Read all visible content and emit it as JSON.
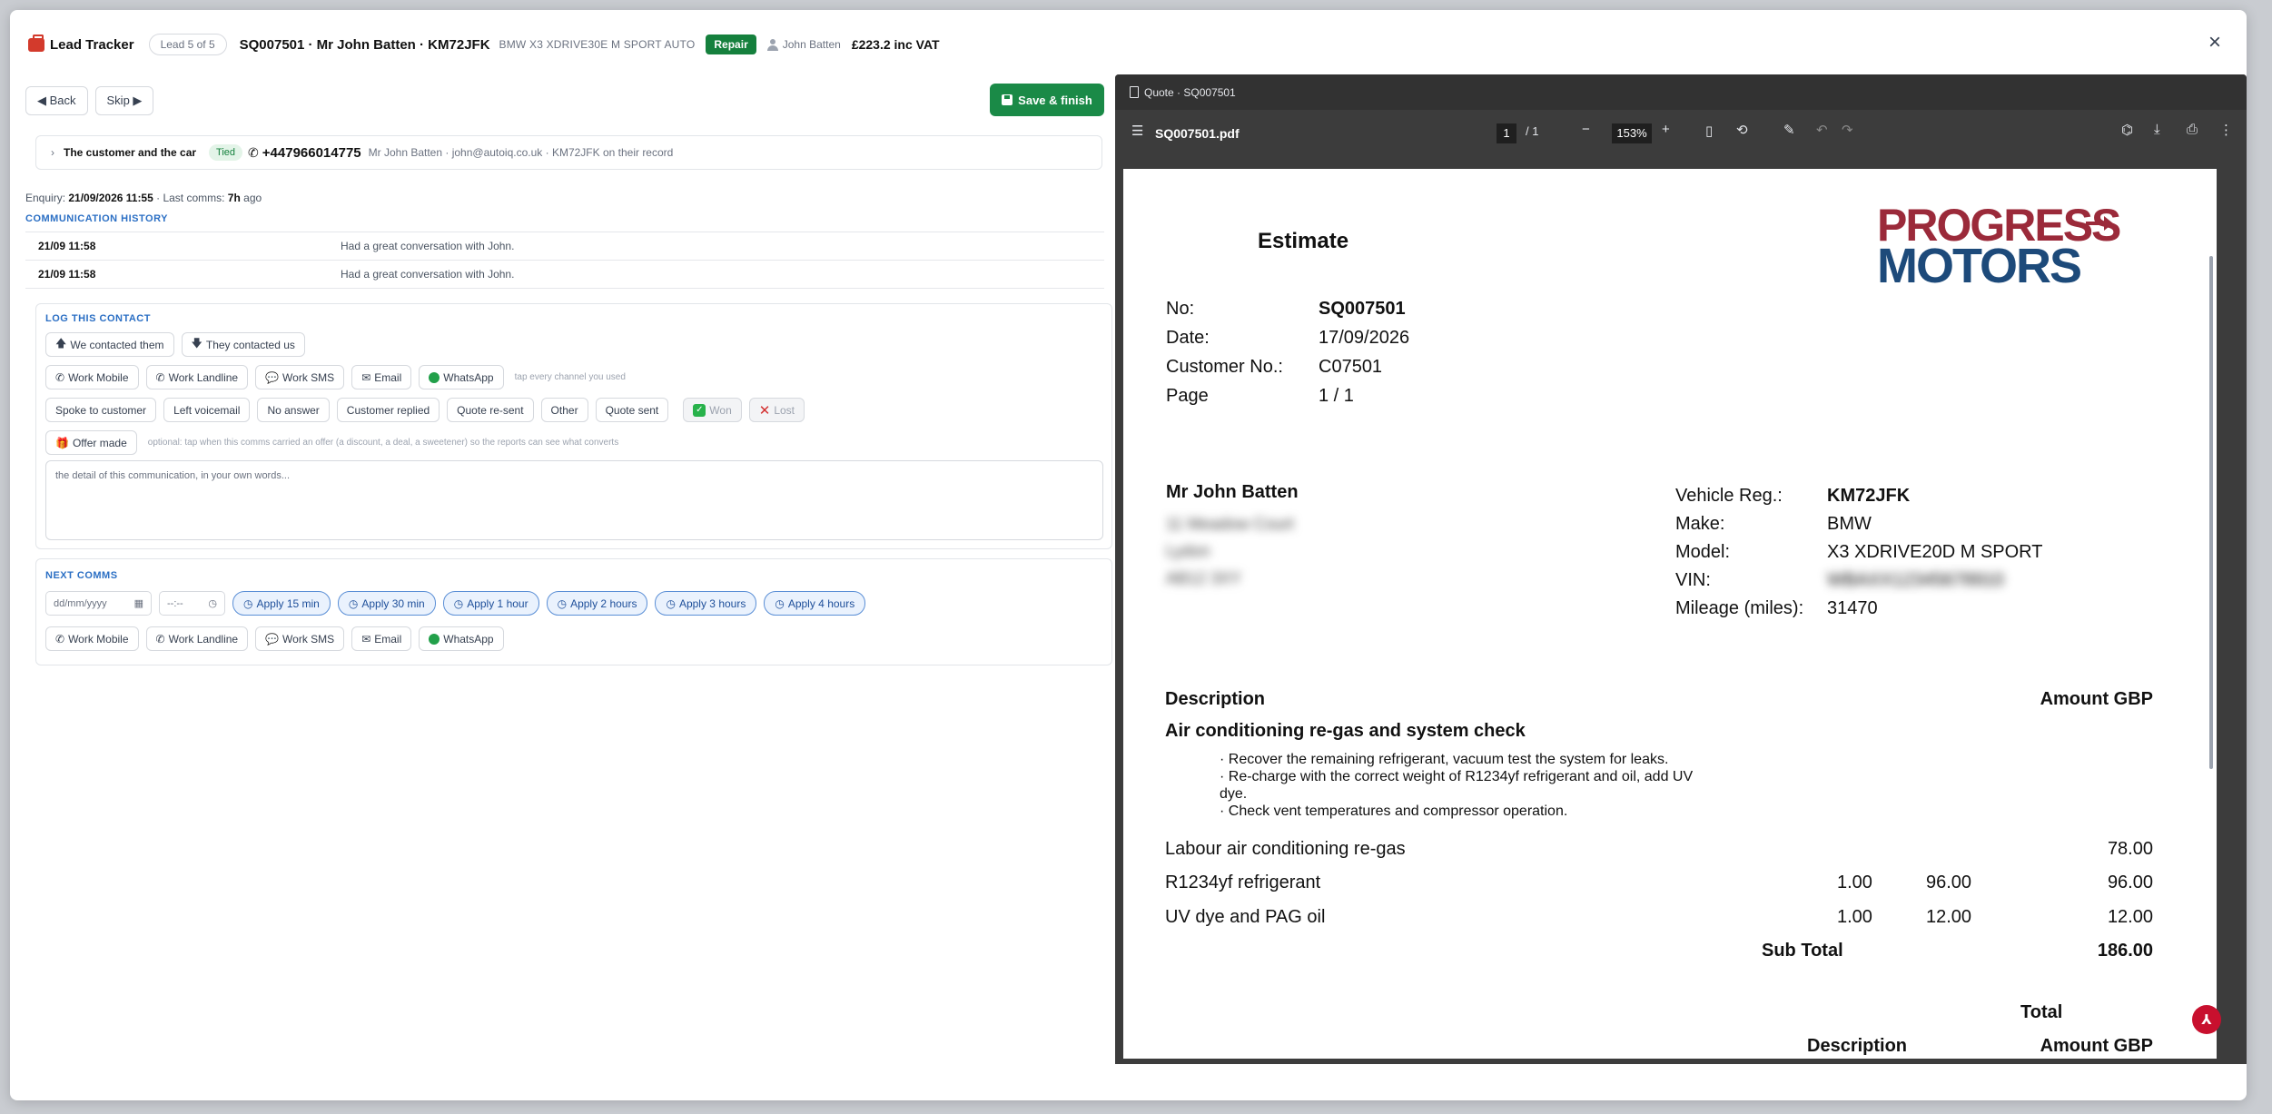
{
  "header": {
    "brand": "Lead Tracker",
    "lead_position": "Lead 5 of 5",
    "title": "SQ007501 · Mr John Batten · KM72JFK",
    "vehicle": "BMW X3 XDRIVE30E M SPORT AUTO",
    "badge": "Repair",
    "user": "John Batten",
    "price": "£223.2 inc VAT",
    "close": "×"
  },
  "toolbar": {
    "back": "◀ Back",
    "skip": "Skip ▶",
    "save": "Save & finish"
  },
  "customer": {
    "chevron": "›",
    "label": "The customer and the car",
    "status": "Tied",
    "phone": "+447966014775",
    "details": "Mr John Batten · john@autoiq.co.uk · KM72JFK on their record"
  },
  "enquiry": {
    "prefix": "Enquiry: ",
    "date": "21/09/2026 11:55",
    "sep": " · Last comms: ",
    "last": "7h",
    "suffix": " ago"
  },
  "history": {
    "title": "COMMUNICATION HISTORY",
    "rows": [
      {
        "time": "21/09 11:58",
        "message": "Had a great conversation with John."
      },
      {
        "time": "21/09 11:58",
        "message": "Had a great conversation with John."
      }
    ]
  },
  "log": {
    "title": "LOG THIS CONTACT",
    "direction": [
      "We contacted them",
      "They contacted us"
    ],
    "channels": [
      "Work Mobile",
      "Work Landline",
      "Work SMS",
      "Email",
      "WhatsApp"
    ],
    "channel_hint": "tap every channel you used",
    "outcomes": [
      "Spoke to customer",
      "Left voicemail",
      "No answer",
      "Customer replied",
      "Quote re-sent",
      "Other",
      "Quote sent"
    ],
    "won": "Won",
    "lost": "Lost",
    "offer": "Offer made",
    "offer_hint": "optional: tap when this comms carried an offer (a discount, a deal, a sweetener) so the reports can see what converts",
    "placeholder": "the detail of this communication, in your own words..."
  },
  "next": {
    "title": "NEXT COMMS",
    "date_placeholder": "dd/mm/yyyy",
    "time_placeholder": "--:--",
    "apply": [
      "Apply 15 min",
      "Apply 30 min",
      "Apply 1 hour",
      "Apply 2 hours",
      "Apply 3 hours",
      "Apply 4 hours"
    ],
    "channels": [
      "Work Mobile",
      "Work Landline",
      "Work SMS",
      "Email",
      "WhatsApp"
    ]
  },
  "pdf": {
    "tab": "Quote · SQ007501",
    "filename": "SQ007501.pdf",
    "page": "1",
    "of": "/  1",
    "zoom": "153%"
  },
  "estimate": {
    "heading": "Estimate",
    "logo_top": "PROGRESS",
    "logo_bottom": "MOTORS",
    "meta": [
      {
        "label": "No:",
        "value": "SQ007501"
      },
      {
        "label": "Date:",
        "value": "17/09/2026"
      },
      {
        "label": "Customer No.:",
        "value": "C07501"
      },
      {
        "label": "Page",
        "value": "1 / 1"
      }
    ],
    "customer_name": "Mr John Batten",
    "address": [
      "11 Meadow Court",
      "Lydon",
      "AB12 3XY"
    ],
    "vehicle": [
      {
        "label": "Vehicle Reg.:",
        "value": "KM72JFK"
      },
      {
        "label": "Make:",
        "value": "BMW"
      },
      {
        "label": "Model:",
        "value": "X3 XDRIVE20D M SPORT"
      },
      {
        "label": "VIN:",
        "value": "WBAXX12345678910"
      },
      {
        "label": "Mileage (miles):",
        "value": "31470"
      }
    ],
    "desc_header": "Description",
    "amount_header": "Amount GBP",
    "job_title": "Air conditioning re-gas and system check",
    "job_lines": [
      "· Recover the remaining refrigerant, vacuum test the system for leaks.",
      "· Re-charge with the correct weight of R1234yf refrigerant and oil, add UV",
      "dye.",
      "· Check vent temperatures and compressor operation."
    ],
    "items": [
      {
        "desc": "Labour air conditioning re-gas",
        "qty": "",
        "price": "",
        "amount": "78.00"
      },
      {
        "desc": "R1234yf refrigerant",
        "qty": "1.00",
        "price": "96.00",
        "amount": "96.00"
      },
      {
        "desc": "UV dye and PAG oil",
        "qty": "1.00",
        "price": "12.00",
        "amount": "12.00"
      }
    ],
    "subtotal_label": "Sub Total",
    "subtotal": "186.00",
    "total_label": "Total",
    "total_desc": "Description",
    "total_amount": "Amount GBP"
  }
}
